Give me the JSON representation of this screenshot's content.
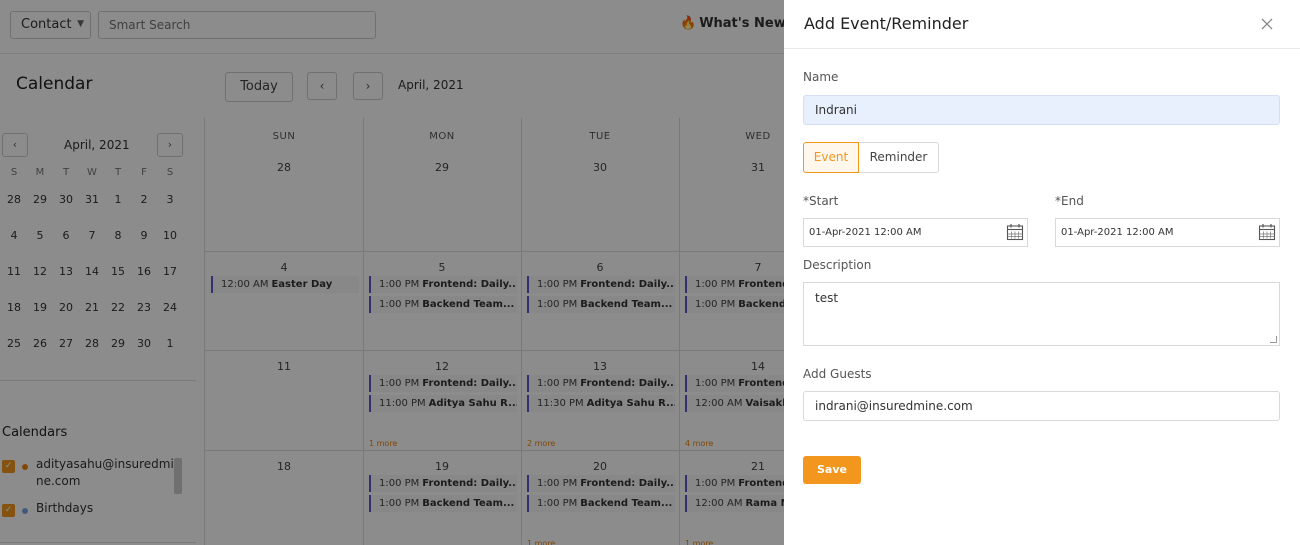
{
  "topbar": {
    "contact_select": "Contact",
    "search_placeholder": "Smart Search",
    "whats_new": "What's New"
  },
  "calendar": {
    "title": "Calendar",
    "today_label": "Today",
    "prev_label": "‹",
    "next_label": "›",
    "month_label": "April, 2021"
  },
  "mini_calendar": {
    "title": "April, 2021",
    "weekdays": [
      "S",
      "M",
      "T",
      "W",
      "T",
      "F",
      "S"
    ],
    "weeks": [
      [
        "28",
        "29",
        "30",
        "31",
        "1",
        "2",
        "3"
      ],
      [
        "4",
        "5",
        "6",
        "7",
        "8",
        "9",
        "10"
      ],
      [
        "11",
        "12",
        "13",
        "14",
        "15",
        "16",
        "17"
      ],
      [
        "18",
        "19",
        "20",
        "21",
        "22",
        "23",
        "24"
      ],
      [
        "25",
        "26",
        "27",
        "28",
        "29",
        "30",
        "1"
      ]
    ]
  },
  "calendars_section": {
    "title": "Calendars",
    "items": [
      {
        "label": "adityasahu@insuredmine.com",
        "line1": "adityasahu@insuredmi",
        "line2": "ne.com",
        "color": "#e8830f"
      },
      {
        "label": "Birthdays",
        "color": "#7aa6e0"
      }
    ]
  },
  "grid": {
    "day_headers": [
      "SUN",
      "MON",
      "TUE",
      "WED"
    ],
    "weeks": [
      {
        "dates": [
          "28",
          "29",
          "30",
          "31"
        ]
      },
      {
        "dates": [
          "4",
          "5",
          "6",
          "7"
        ]
      },
      {
        "dates": [
          "11",
          "12",
          "13",
          "14"
        ]
      },
      {
        "dates": [
          "18",
          "19",
          "20",
          "21"
        ]
      }
    ],
    "events": [
      {
        "week": 1,
        "col": 0,
        "slot": 0,
        "time": "12:00 AM",
        "title": "Easter Day"
      },
      {
        "week": 1,
        "col": 1,
        "slot": 0,
        "time": "1:00 PM",
        "title": "Frontend: Daily..."
      },
      {
        "week": 1,
        "col": 1,
        "slot": 1,
        "time": "1:00 PM",
        "title": "Backend Team..."
      },
      {
        "week": 1,
        "col": 2,
        "slot": 0,
        "time": "1:00 PM",
        "title": "Frontend: Daily..."
      },
      {
        "week": 1,
        "col": 2,
        "slot": 1,
        "time": "1:00 PM",
        "title": "Backend Team..."
      },
      {
        "week": 1,
        "col": 3,
        "slot": 0,
        "time": "1:00 PM",
        "title": "Frontend"
      },
      {
        "week": 1,
        "col": 3,
        "slot": 1,
        "time": "1:00 PM",
        "title": "Backend"
      },
      {
        "week": 2,
        "col": 1,
        "slot": 0,
        "time": "1:00 PM",
        "title": "Frontend: Daily..."
      },
      {
        "week": 2,
        "col": 1,
        "slot": 1,
        "time": "11:00 PM",
        "title": "Aditya Sahu R..."
      },
      {
        "week": 2,
        "col": 2,
        "slot": 0,
        "time": "1:00 PM",
        "title": "Frontend: Daily..."
      },
      {
        "week": 2,
        "col": 2,
        "slot": 1,
        "time": "11:30 PM",
        "title": "Aditya Sahu R..."
      },
      {
        "week": 2,
        "col": 3,
        "slot": 0,
        "time": "1:00 PM",
        "title": "Frontend"
      },
      {
        "week": 2,
        "col": 3,
        "slot": 1,
        "time": "12:00 AM",
        "title": "Vaisakh"
      },
      {
        "week": 3,
        "col": 1,
        "slot": 0,
        "time": "1:00 PM",
        "title": "Frontend: Daily..."
      },
      {
        "week": 3,
        "col": 1,
        "slot": 1,
        "time": "1:00 PM",
        "title": "Backend Team..."
      },
      {
        "week": 3,
        "col": 2,
        "slot": 0,
        "time": "1:00 PM",
        "title": "Frontend: Daily..."
      },
      {
        "week": 3,
        "col": 2,
        "slot": 1,
        "time": "1:00 PM",
        "title": "Backend Team..."
      },
      {
        "week": 3,
        "col": 3,
        "slot": 0,
        "time": "1:00 PM",
        "title": "Frontend"
      },
      {
        "week": 3,
        "col": 3,
        "slot": 1,
        "time": "12:00 AM",
        "title": "Rama N"
      }
    ],
    "more_links": [
      {
        "week": 2,
        "col": 1,
        "label": "1 more"
      },
      {
        "week": 2,
        "col": 2,
        "label": "2 more"
      },
      {
        "week": 2,
        "col": 3,
        "label": "4 more"
      },
      {
        "week": 3,
        "col": 2,
        "label": "1 more"
      },
      {
        "week": 3,
        "col": 3,
        "label": "1 more"
      }
    ]
  },
  "drawer": {
    "title": "Add Event/Reminder",
    "name_label": "Name",
    "name_value": "Indrani",
    "type_event": "Event",
    "type_reminder": "Reminder",
    "start_label": "*Start",
    "start_value": "01-Apr-2021 12:00 AM",
    "end_label": "*End",
    "end_value": "01-Apr-2021 12:00 AM",
    "description_label": "Description",
    "description_value": "test",
    "guests_label": "Add Guests",
    "guests_value": "indrani@insuredmine.com",
    "save_label": "Save"
  },
  "colors": {
    "accent": "#f2961e",
    "event_bar": "#5a5ad0",
    "name_field_bg": "#e8f0fe"
  }
}
